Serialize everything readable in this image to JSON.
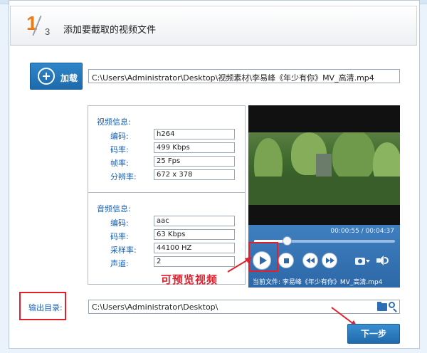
{
  "step": {
    "current": "1",
    "total": "3",
    "title": "添加要截取的视频文件"
  },
  "add_button": {
    "label": "加载"
  },
  "file_path": "C:\\Users\\Administrator\\Desktop\\视频素材\\李易峰《年少有你》MV_高清.mp4",
  "video_info": {
    "title": "视频信息:",
    "rows": [
      {
        "key": "编码:",
        "value": "h264"
      },
      {
        "key": "码率:",
        "value": "499 Kbps"
      },
      {
        "key": "帧率:",
        "value": "25 Fps"
      },
      {
        "key": "分辨率:",
        "value": "672 x 378"
      }
    ]
  },
  "audio_info": {
    "title": "音频信息:",
    "rows": [
      {
        "key": "编码:",
        "value": "aac"
      },
      {
        "key": "码率:",
        "value": "63 Kbps"
      },
      {
        "key": "采样率:",
        "value": "44100 HZ"
      },
      {
        "key": "声道:",
        "value": "2"
      }
    ]
  },
  "player": {
    "time": "00:00:55 / 00:04:37",
    "progress": 0.23,
    "current_file": "当前文件: 李易峰《年少有你》MV_高清.mp4"
  },
  "annotation": {
    "preview_note": "可预览视频"
  },
  "output": {
    "label": "输出目录:",
    "path": "C:\\Users\\Administrator\\Desktop\\"
  },
  "next_button": {
    "label": "下一步"
  },
  "colors": {
    "accent": "#2d68a8",
    "step_orange": "#f07b14",
    "highlight_red": "#e0202a",
    "label_blue": "#1a62b5"
  },
  "icons": [
    "plus-icon",
    "play-icon",
    "stop-icon",
    "rewind-icon",
    "forward-icon",
    "camera-icon",
    "volume-icon",
    "folder-search-icon"
  ]
}
